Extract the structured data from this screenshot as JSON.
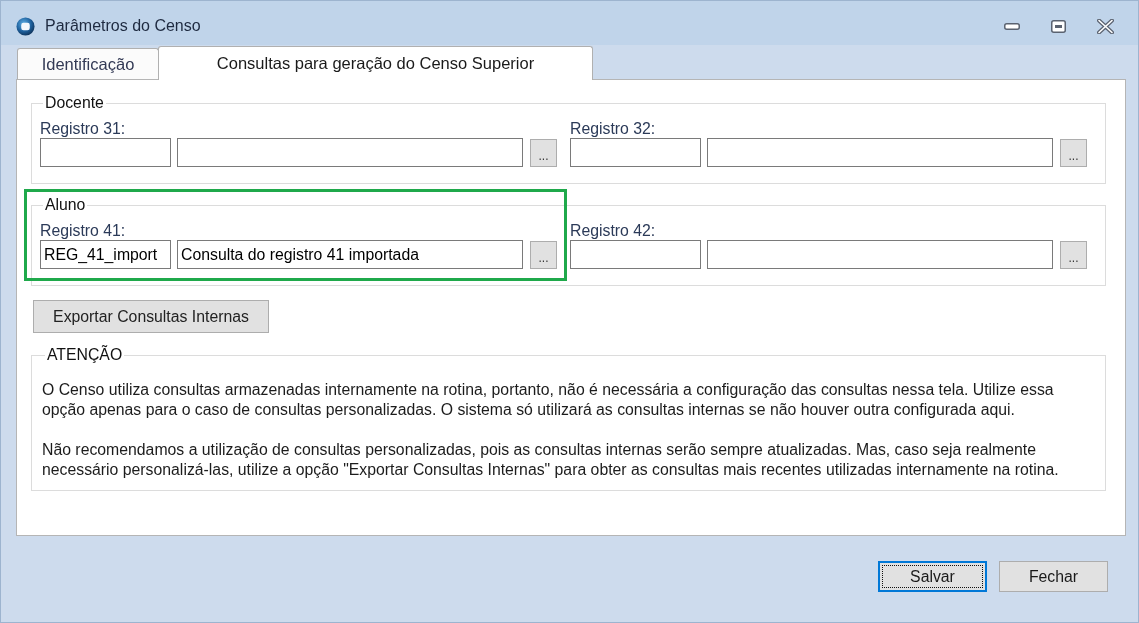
{
  "window": {
    "title": "Parâmetros do Censo"
  },
  "tabs": [
    {
      "label": "Identificação",
      "selected": false
    },
    {
      "label": "Consultas para geração do Censo Superior",
      "selected": true
    }
  ],
  "groups": [
    {
      "title": "Docente",
      "fields": [
        {
          "label": "Registro 31:",
          "button": "...",
          "highlighted": false
        },
        {
          "label": "Registro 32:",
          "button": "...",
          "highlighted": false
        }
      ]
    },
    {
      "title": "Aluno",
      "fields": [
        {
          "label": "Registro 41:",
          "code": "REG_41_import",
          "description": "Consulta do registro 41 importada",
          "button": "...",
          "highlighted": true
        },
        {
          "label": "Registro 42:",
          "button": "...",
          "highlighted": false
        }
      ]
    }
  ],
  "export_button": "Exportar Consultas Internas",
  "notice": {
    "title": "ATENÇÃO",
    "paragraphs": [
      "O Censo utiliza consultas armazenadas internamente na rotina, portanto, não é necessária a configuração das consultas nessa tela. Utilize essa\nopção apenas para o caso de consultas personalizadas. O sistema só utilizará as consultas internas se não houver outra configurada aqui.",
      "Não recomendamos a utilização de consultas personalizadas, pois as consultas internas serão sempre atualizadas. Mas, caso seja realmente\nnecessário personalizá-las, utilize a opção \"Exportar Consultas Internas\" para obter as consultas mais recentes utilizadas internamente na rotina."
    ]
  },
  "buttons": [
    {
      "label": "Salvar",
      "focused": true
    },
    {
      "label": "Fechar",
      "focused": false
    }
  ]
}
